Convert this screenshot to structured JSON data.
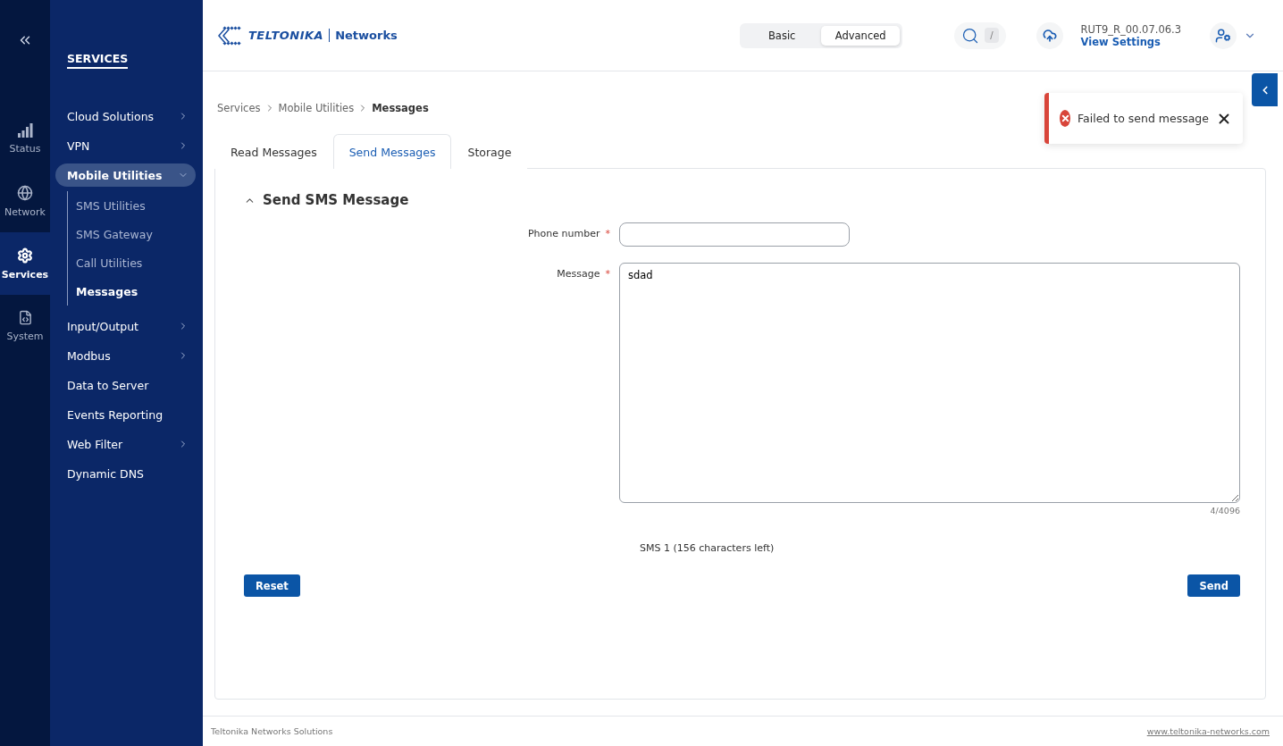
{
  "rail": {
    "items": [
      {
        "kind": "status",
        "label": "Status",
        "selected": false
      },
      {
        "kind": "network",
        "label": "Network",
        "selected": false
      },
      {
        "kind": "services",
        "label": "Services",
        "selected": true
      },
      {
        "kind": "system",
        "label": "System",
        "selected": false
      }
    ]
  },
  "nav": {
    "title": "SERVICES",
    "items": [
      {
        "kind": "group",
        "label": "Cloud Solutions",
        "expanded": false,
        "selected": false
      },
      {
        "kind": "group",
        "label": "VPN",
        "expanded": false,
        "selected": false
      },
      {
        "kind": "group",
        "label": "Mobile Utilities",
        "expanded": true,
        "selected": true,
        "children": [
          {
            "label": "SMS Utilities",
            "selected": false
          },
          {
            "label": "SMS Gateway",
            "selected": false
          },
          {
            "label": "Call Utilities",
            "selected": false
          },
          {
            "label": "Messages",
            "selected": true
          }
        ]
      },
      {
        "kind": "group",
        "label": "Input/Output",
        "expanded": false,
        "selected": false
      },
      {
        "kind": "group",
        "label": "Modbus",
        "expanded": false,
        "selected": false
      },
      {
        "kind": "link",
        "label": "Data to Server",
        "selected": false
      },
      {
        "kind": "link",
        "label": "Events Reporting",
        "selected": false
      },
      {
        "kind": "group",
        "label": "Web Filter",
        "expanded": false,
        "selected": false
      },
      {
        "kind": "link",
        "label": "Dynamic DNS",
        "selected": false
      }
    ]
  },
  "header": {
    "logo": {
      "brand": "TELTONIKA",
      "product": "Networks"
    },
    "modes": [
      {
        "label": "Basic",
        "selected": false
      },
      {
        "label": "Advanced",
        "selected": true
      }
    ],
    "search": {
      "shortcut": "/"
    },
    "firmware": "RUT9_R_00.07.06.3",
    "settings_link": "View Settings"
  },
  "breadcrumb": [
    "Services",
    "Mobile Utilities",
    "Messages"
  ],
  "tabs": [
    {
      "label": "Read Messages",
      "selected": false
    },
    {
      "label": "Send Messages",
      "selected": true
    },
    {
      "label": "Storage",
      "selected": false
    }
  ],
  "section": {
    "title": "Send SMS Message",
    "expanded": true,
    "fields": [
      {
        "kind": "input",
        "label": "Phone number",
        "required_mark": "*"
      },
      {
        "kind": "textarea",
        "label": "Message",
        "required_mark": "*",
        "value": "sdad",
        "counter": "4/4096"
      }
    ],
    "sms_info": "SMS 1 (156 characters left)",
    "buttons": [
      {
        "label": "Reset"
      },
      {
        "label": "Send"
      }
    ]
  },
  "toast": {
    "kind": "error",
    "message": "Failed to send message"
  },
  "footer": {
    "left": "Teltonika Networks Solutions",
    "right": "www.teltonika-networks.com"
  }
}
